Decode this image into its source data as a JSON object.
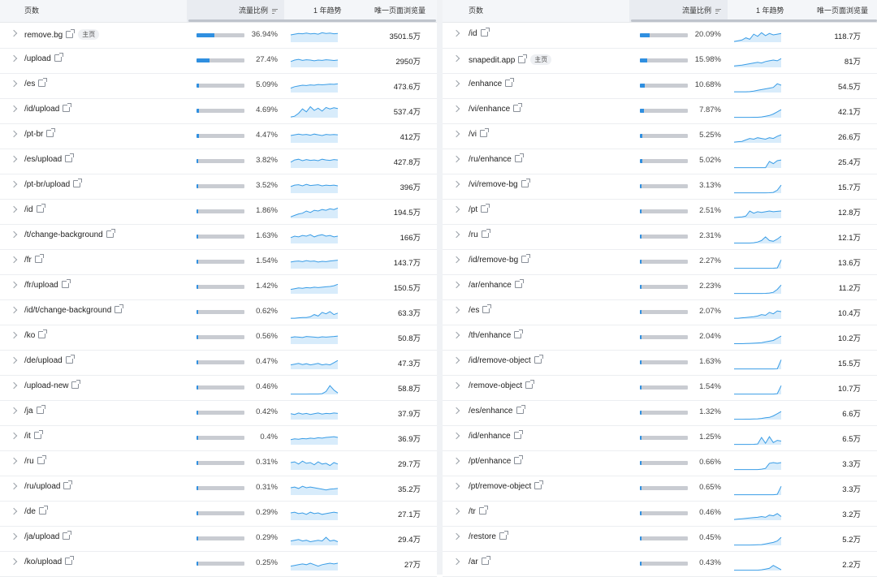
{
  "header": {
    "page_col": "页数",
    "share_col": "流量比例",
    "trend_col": "1 年趋势",
    "views_col": "唯一页面浏览量"
  },
  "badge_label": "主页",
  "colors": {
    "bar_fill": "#2f8fe0",
    "bar_track": "#c9ccd2",
    "spark_line": "#3a9de6",
    "spark_area": "#d8ecfb"
  },
  "left": [
    {
      "page": "remove.bg",
      "badge": true,
      "share": "36.94%",
      "share_value": 36.94,
      "views": "3501.5万",
      "trend": [
        0.5,
        0.55,
        0.6,
        0.58,
        0.62,
        0.57,
        0.6,
        0.55,
        0.65,
        0.6,
        0.62,
        0.58,
        0.6
      ]
    },
    {
      "page": "/upload",
      "share": "27.4%",
      "share_value": 27.4,
      "views": "2950万",
      "trend": [
        0.4,
        0.5,
        0.55,
        0.48,
        0.52,
        0.5,
        0.45,
        0.5,
        0.48,
        0.52,
        0.5,
        0.47,
        0.5
      ]
    },
    {
      "page": "/es",
      "share": "5.09%",
      "share_value": 5.09,
      "views": "473.6万",
      "trend": [
        0.3,
        0.4,
        0.45,
        0.5,
        0.48,
        0.52,
        0.5,
        0.55,
        0.53,
        0.55,
        0.58,
        0.56,
        0.6
      ]
    },
    {
      "page": "/id/upload",
      "share": "4.69%",
      "share_value": 4.69,
      "views": "537.4万",
      "trend": [
        0.05,
        0.1,
        0.3,
        0.6,
        0.4,
        0.75,
        0.5,
        0.65,
        0.45,
        0.7,
        0.6,
        0.68,
        0.62
      ]
    },
    {
      "page": "/pt-br",
      "share": "4.47%",
      "share_value": 4.47,
      "views": "412万",
      "trend": [
        0.5,
        0.55,
        0.6,
        0.55,
        0.58,
        0.52,
        0.6,
        0.55,
        0.5,
        0.58,
        0.55,
        0.57,
        0.55
      ]
    },
    {
      "page": "/es/upload",
      "share": "3.82%",
      "share_value": 3.82,
      "views": "427.8万",
      "trend": [
        0.4,
        0.55,
        0.6,
        0.5,
        0.58,
        0.52,
        0.55,
        0.5,
        0.6,
        0.55,
        0.52,
        0.58,
        0.55
      ]
    },
    {
      "page": "/pt-br/upload",
      "share": "3.52%",
      "share_value": 3.52,
      "views": "396万",
      "trend": [
        0.45,
        0.55,
        0.58,
        0.5,
        0.6,
        0.52,
        0.55,
        0.58,
        0.5,
        0.55,
        0.52,
        0.55,
        0.5
      ]
    },
    {
      "page": "/id",
      "share": "1.86%",
      "share_value": 1.86,
      "views": "194.5万",
      "trend": [
        0.1,
        0.2,
        0.3,
        0.35,
        0.5,
        0.4,
        0.55,
        0.5,
        0.6,
        0.55,
        0.65,
        0.6,
        0.7
      ]
    },
    {
      "page": "/t/change-background",
      "share": "1.63%",
      "share_value": 1.63,
      "views": "166万",
      "trend": [
        0.4,
        0.5,
        0.45,
        0.55,
        0.5,
        0.6,
        0.45,
        0.55,
        0.6,
        0.5,
        0.55,
        0.45,
        0.5
      ]
    },
    {
      "page": "/fr",
      "share": "1.54%",
      "share_value": 1.54,
      "views": "143.7万",
      "trend": [
        0.45,
        0.5,
        0.52,
        0.48,
        0.55,
        0.5,
        0.52,
        0.45,
        0.5,
        0.48,
        0.52,
        0.55,
        0.58
      ]
    },
    {
      "page": "/fr/upload",
      "share": "1.42%",
      "share_value": 1.42,
      "views": "150.5万",
      "trend": [
        0.3,
        0.35,
        0.4,
        0.38,
        0.42,
        0.4,
        0.45,
        0.42,
        0.45,
        0.48,
        0.5,
        0.55,
        0.65
      ]
    },
    {
      "page": "/id/t/change-background",
      "share": "0.62%",
      "share_value": 0.62,
      "views": "63.3万",
      "trend": [
        0.05,
        0.05,
        0.08,
        0.1,
        0.1,
        0.15,
        0.3,
        0.2,
        0.45,
        0.35,
        0.5,
        0.3,
        0.4
      ]
    },
    {
      "page": "/ko",
      "share": "0.56%",
      "share_value": 0.56,
      "views": "50.8万",
      "trend": [
        0.45,
        0.5,
        0.48,
        0.45,
        0.52,
        0.5,
        0.48,
        0.45,
        0.5,
        0.48,
        0.5,
        0.52,
        0.55
      ]
    },
    {
      "page": "/de/upload",
      "share": "0.47%",
      "share_value": 0.47,
      "views": "47.3万",
      "trend": [
        0.3,
        0.35,
        0.4,
        0.32,
        0.38,
        0.3,
        0.35,
        0.4,
        0.3,
        0.35,
        0.3,
        0.45,
        0.6
      ]
    },
    {
      "page": "/upload-new",
      "share": "0.46%",
      "share_value": 0.46,
      "views": "58.8万",
      "trend": [
        0.02,
        0.02,
        0.02,
        0.02,
        0.02,
        0.03,
        0.03,
        0.03,
        0.05,
        0.2,
        0.6,
        0.3,
        0.1
      ]
    },
    {
      "page": "/ja",
      "share": "0.42%",
      "share_value": 0.42,
      "views": "37.9万",
      "trend": [
        0.4,
        0.35,
        0.45,
        0.38,
        0.42,
        0.35,
        0.4,
        0.45,
        0.38,
        0.42,
        0.4,
        0.45,
        0.42
      ]
    },
    {
      "page": "/it",
      "share": "0.4%",
      "share_value": 0.4,
      "views": "36.9万",
      "trend": [
        0.35,
        0.4,
        0.38,
        0.42,
        0.4,
        0.45,
        0.42,
        0.48,
        0.45,
        0.5,
        0.52,
        0.55,
        0.5
      ]
    },
    {
      "page": "/ru",
      "share": "0.31%",
      "share_value": 0.31,
      "views": "29.7万",
      "trend": [
        0.5,
        0.55,
        0.4,
        0.6,
        0.45,
        0.5,
        0.35,
        0.55,
        0.4,
        0.45,
        0.3,
        0.5,
        0.4
      ]
    },
    {
      "page": "/ru/upload",
      "share": "0.31%",
      "share_value": 0.31,
      "views": "35.2万",
      "trend": [
        0.5,
        0.55,
        0.45,
        0.6,
        0.5,
        0.55,
        0.5,
        0.45,
        0.4,
        0.35,
        0.4,
        0.42,
        0.45
      ]
    },
    {
      "page": "/de",
      "share": "0.29%",
      "share_value": 0.29,
      "views": "27.1万",
      "trend": [
        0.5,
        0.55,
        0.45,
        0.5,
        0.4,
        0.55,
        0.45,
        0.5,
        0.4,
        0.45,
        0.5,
        0.55,
        0.5
      ]
    },
    {
      "page": "/ja/upload",
      "share": "0.29%",
      "share_value": 0.29,
      "views": "29.4万",
      "trend": [
        0.3,
        0.35,
        0.4,
        0.3,
        0.35,
        0.25,
        0.3,
        0.35,
        0.3,
        0.55,
        0.3,
        0.35,
        0.25
      ]
    },
    {
      "page": "/ko/upload",
      "share": "0.25%",
      "share_value": 0.25,
      "views": "27万",
      "trend": [
        0.3,
        0.35,
        0.4,
        0.45,
        0.4,
        0.5,
        0.4,
        0.3,
        0.4,
        0.45,
        0.5,
        0.45,
        0.5
      ]
    }
  ],
  "right": [
    {
      "page": "/id",
      "share": "20.09%",
      "share_value": 20.09,
      "views": "118.7万",
      "trend": [
        0.05,
        0.1,
        0.15,
        0.3,
        0.2,
        0.55,
        0.4,
        0.65,
        0.45,
        0.6,
        0.5,
        0.55,
        0.6
      ]
    },
    {
      "page": "snapedit.app",
      "badge": true,
      "share": "15.98%",
      "share_value": 15.98,
      "views": "81万",
      "trend": [
        0.1,
        0.12,
        0.15,
        0.2,
        0.25,
        0.3,
        0.35,
        0.3,
        0.4,
        0.45,
        0.5,
        0.45,
        0.6
      ]
    },
    {
      "page": "/enhance",
      "share": "10.68%",
      "share_value": 10.68,
      "views": "54.5万",
      "trend": [
        0.05,
        0.05,
        0.05,
        0.05,
        0.06,
        0.1,
        0.15,
        0.2,
        0.25,
        0.3,
        0.35,
        0.6,
        0.5
      ]
    },
    {
      "page": "/vi/enhance",
      "share": "7.87%",
      "share_value": 7.87,
      "views": "42.1万",
      "trend": [
        0.02,
        0.02,
        0.02,
        0.02,
        0.02,
        0.03,
        0.03,
        0.05,
        0.1,
        0.15,
        0.25,
        0.4,
        0.55
      ]
    },
    {
      "page": "/vi",
      "share": "5.25%",
      "share_value": 5.25,
      "views": "26.6万",
      "trend": [
        0.05,
        0.08,
        0.1,
        0.2,
        0.3,
        0.25,
        0.35,
        0.3,
        0.25,
        0.35,
        0.3,
        0.45,
        0.55
      ]
    },
    {
      "page": "/ru/enhance",
      "share": "5.02%",
      "share_value": 5.02,
      "views": "25.4万",
      "trend": [
        0.02,
        0.02,
        0.02,
        0.02,
        0.02,
        0.02,
        0.02,
        0.02,
        0.02,
        0.45,
        0.3,
        0.5,
        0.55
      ]
    },
    {
      "page": "/vi/remove-bg",
      "share": "3.13%",
      "share_value": 3.13,
      "views": "15.7万",
      "trend": [
        0.02,
        0.02,
        0.02,
        0.02,
        0.02,
        0.02,
        0.02,
        0.02,
        0.02,
        0.03,
        0.05,
        0.2,
        0.55
      ]
    },
    {
      "page": "/pt",
      "share": "2.51%",
      "share_value": 2.51,
      "views": "12.8万",
      "trend": [
        0.05,
        0.08,
        0.1,
        0.15,
        0.5,
        0.35,
        0.45,
        0.4,
        0.45,
        0.5,
        0.45,
        0.48,
        0.5
      ]
    },
    {
      "page": "/ru",
      "share": "2.31%",
      "share_value": 2.31,
      "views": "12.1万",
      "trend": [
        0.03,
        0.03,
        0.03,
        0.03,
        0.03,
        0.05,
        0.1,
        0.2,
        0.45,
        0.2,
        0.15,
        0.3,
        0.5
      ]
    },
    {
      "page": "/id/remove-bg",
      "share": "2.27%",
      "share_value": 2.27,
      "views": "13.6万",
      "trend": [
        0.02,
        0.02,
        0.02,
        0.02,
        0.02,
        0.02,
        0.02,
        0.02,
        0.02,
        0.02,
        0.03,
        0.05,
        0.6
      ]
    },
    {
      "page": "/ar/enhance",
      "share": "2.23%",
      "share_value": 2.23,
      "views": "11.2万",
      "trend": [
        0.02,
        0.02,
        0.02,
        0.02,
        0.02,
        0.02,
        0.02,
        0.02,
        0.03,
        0.05,
        0.1,
        0.3,
        0.6
      ]
    },
    {
      "page": "/es",
      "share": "2.07%",
      "share_value": 2.07,
      "views": "10.4万",
      "trend": [
        0.05,
        0.05,
        0.08,
        0.1,
        0.12,
        0.15,
        0.2,
        0.3,
        0.25,
        0.45,
        0.35,
        0.55,
        0.5
      ]
    },
    {
      "page": "/th/enhance",
      "share": "2.04%",
      "share_value": 2.04,
      "views": "10.2万",
      "trend": [
        0.03,
        0.03,
        0.03,
        0.04,
        0.05,
        0.06,
        0.08,
        0.1,
        0.15,
        0.2,
        0.25,
        0.4,
        0.55
      ]
    },
    {
      "page": "/id/remove-object",
      "share": "1.63%",
      "share_value": 1.63,
      "views": "15.5万",
      "trend": [
        0.02,
        0.02,
        0.02,
        0.02,
        0.02,
        0.02,
        0.02,
        0.02,
        0.02,
        0.02,
        0.02,
        0.03,
        0.65
      ]
    },
    {
      "page": "/remove-object",
      "share": "1.54%",
      "share_value": 1.54,
      "views": "10.7万",
      "trend": [
        0.02,
        0.02,
        0.02,
        0.02,
        0.02,
        0.02,
        0.02,
        0.02,
        0.02,
        0.02,
        0.02,
        0.05,
        0.6
      ]
    },
    {
      "page": "/es/enhance",
      "share": "1.32%",
      "share_value": 1.32,
      "views": "6.6万",
      "trend": [
        0.02,
        0.02,
        0.02,
        0.03,
        0.03,
        0.04,
        0.05,
        0.08,
        0.12,
        0.15,
        0.25,
        0.4,
        0.55
      ]
    },
    {
      "page": "/id/enhance",
      "share": "1.25%",
      "share_value": 1.25,
      "views": "6.5万",
      "trend": [
        0.02,
        0.02,
        0.02,
        0.02,
        0.02,
        0.03,
        0.05,
        0.5,
        0.1,
        0.55,
        0.15,
        0.3,
        0.25
      ]
    },
    {
      "page": "/pt/enhance",
      "share": "0.66%",
      "share_value": 0.66,
      "views": "3.3万",
      "trend": [
        0.02,
        0.02,
        0.02,
        0.02,
        0.02,
        0.02,
        0.02,
        0.05,
        0.1,
        0.45,
        0.5,
        0.45,
        0.5
      ]
    },
    {
      "page": "/pt/remove-object",
      "share": "0.65%",
      "share_value": 0.65,
      "views": "3.3万",
      "trend": [
        0.02,
        0.02,
        0.02,
        0.02,
        0.02,
        0.02,
        0.02,
        0.02,
        0.02,
        0.02,
        0.02,
        0.05,
        0.6
      ]
    },
    {
      "page": "/tr",
      "share": "0.46%",
      "share_value": 0.46,
      "views": "3.2万",
      "trend": [
        0.05,
        0.08,
        0.1,
        0.12,
        0.15,
        0.18,
        0.2,
        0.25,
        0.2,
        0.35,
        0.3,
        0.45,
        0.25
      ]
    },
    {
      "page": "/restore",
      "share": "0.45%",
      "share_value": 0.45,
      "views": "5.2万",
      "trend": [
        0.02,
        0.02,
        0.02,
        0.02,
        0.02,
        0.03,
        0.04,
        0.05,
        0.1,
        0.15,
        0.2,
        0.3,
        0.55
      ]
    },
    {
      "page": "/ar",
      "share": "0.43%",
      "share_value": 0.43,
      "views": "2.2万",
      "trend": [
        0.02,
        0.02,
        0.02,
        0.02,
        0.02,
        0.02,
        0.02,
        0.05,
        0.1,
        0.15,
        0.35,
        0.2,
        0.05
      ]
    }
  ]
}
